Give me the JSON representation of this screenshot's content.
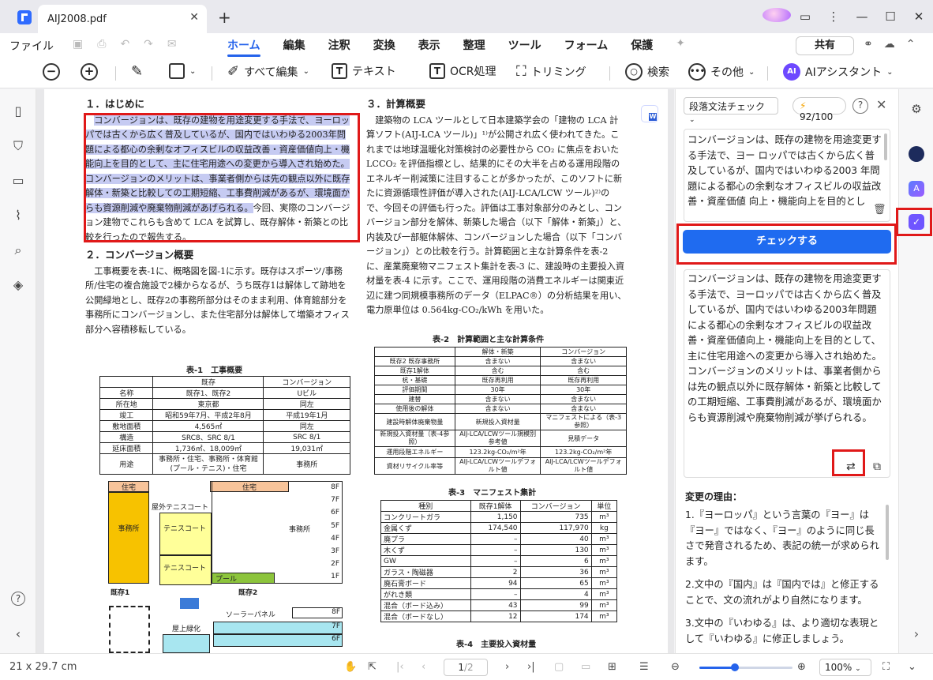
{
  "window": {
    "tab_title": "AIJ2008.pdf",
    "close_glyph": "✕",
    "newtab_glyph": "+",
    "min_glyph": "—",
    "max_glyph": "☐",
    "win_close_glyph": "✕"
  },
  "menu": {
    "file_label": "ファイル",
    "tabs": [
      "ホーム",
      "編集",
      "注釈",
      "変換",
      "表示",
      "整理",
      "ツール",
      "フォーム",
      "保護"
    ],
    "active_tab": "ホーム",
    "share_label": "共有"
  },
  "toolbar": {
    "edit_all": "すべて編集",
    "text": "テキスト",
    "ocr": "OCR処理",
    "trim": "トリミング",
    "search": "検索",
    "more": "その他",
    "ai_assistant": "AIアシスタント",
    "ai_badge": "AI"
  },
  "document": {
    "sec1_title": "１．はじめに",
    "sec1_highlighted": "コンバージョンは、既存の建物を用途変更する手法で、ヨーロッパでは古くから広く普及しているが、国内ではいわゆる2003年問題による都心の余剰なオフィスビルの収益改善・資産価値向上・機能向上を目的として、主に住宅用途への変更から導入され始めた。コンバージョンのメリットは、事業者側からは先の観点以外に既存解体・新築と比較しての工期短縮、工事費削減があるが、環境面からも資源削減や廃棄物削減があげられる。",
    "sec1_rest": "今回、実際のコンバージョン建物でこれらも含めて LCA を試算し、既存解体・新築との比較を行ったので報告する。",
    "sec2_title": "２．コンバージョン概要",
    "sec2_body": "工事概要を表-1に、概略図を図-1に示す。既存はスポーツ/事務所/住宅の複合施設で2棟からなるが、うち既存1は解体して跡地を公開緑地とし、既存2の事務所部分はそのまま利用、体育館部分を事務所にコンバージョンし、また住宅部分は解体して増築オフィス部分へ容積移転している。",
    "sec3_title": "３．計算概要",
    "sec3_body": "建築物の LCA ツールとして日本建築学会の「建物の LCA 計算ソフト(AIJ-LCA ツール)」¹⁾が公開され広く使われてきた。これまでは地球温暖化対策検討の必要性から CO₂ に焦点をおいた LCCO₂ を評価指標とし、結果的にその大半を占める運用段階のエネルギー削減策に注目することが多かったが、このソフトに新たに資源循環性評価が導入された(AIJ-LCA/LCW ツール)²⁾ので、今回その評価も行った。評価は工事対象部分のみとし、コンバージョン部分を解体、新築した場合（以下「解体・新築」）と、内装及び一部躯体解体、コンバージョンした場合（以下「コンバージョン」）との比較を行う。計算範囲と主な計算条件を表-2 に、産業廃棄物マニフェスト集計を表-3 に、建設時の主要投入資材量を表-4 に示す。ここで、運用段階の消費エネルギーは関東近辺に建つ同規模事務所のデータ（ELPAC®）の分析結果を用い、電力原単位は 0.564kg-CO₂/kWh を用いた。",
    "table1": {
      "caption": "表-1　工事概要",
      "header": [
        "",
        "既存",
        "コンバージョン"
      ],
      "rows": [
        [
          "名称",
          "既存1、既存2",
          "Uビル"
        ],
        [
          "所在地",
          "東京都",
          "同左"
        ],
        [
          "竣工",
          "昭和59年7月、平成2年8月",
          "平成19年1月"
        ],
        [
          "敷地面積",
          "4,565㎡",
          "同左"
        ],
        [
          "構造",
          "SRC8、SRC 8/1",
          "SRC 8/1"
        ],
        [
          "延床面積",
          "1,736㎡、18,009㎡",
          "19,031㎡"
        ],
        [
          "用途",
          "事務所・住宅、事務所・体育館(プール・テニス)・住宅",
          "事務所"
        ]
      ]
    },
    "table2": {
      "caption": "表-2　計算範囲と主な計算条件",
      "header": [
        "",
        "解体・新築",
        "コンバージョン"
      ],
      "rows": [
        [
          "既存2 既存事務所",
          "含まない",
          "含まない"
        ],
        [
          "既存1解体",
          "含む",
          "含む"
        ],
        [
          "杭・基礎",
          "既存再利用",
          "既存再利用"
        ],
        [
          "評価期間",
          "30年",
          "30年"
        ],
        [
          "建替",
          "含まない",
          "含まない"
        ],
        [
          "使用後の解体",
          "含まない",
          "含まない"
        ],
        [
          "建設時解体廃棄物量",
          "新規投入資材量",
          "マニフェストによる（表-3参照）"
        ],
        [
          "新規投入資材量（表-4参照）",
          "AIJ-LCA/LCWツール規模別参考値",
          "見積データ"
        ],
        [
          "運用段階エネルギー",
          "123.2kg-CO₂/m²年",
          "123.2kg-CO₂/m²年"
        ],
        [
          "資材リサイクル率等",
          "AIJ-LCA/LCWツールデフォルト値",
          "AIJ-LCA/LCWツールデフォルト値"
        ]
      ]
    },
    "table3": {
      "caption": "表-3　マニフェスト集計",
      "header": [
        "種別",
        "既存1解体",
        "コンバージョン",
        "単位"
      ],
      "rows": [
        [
          "コンクリートガラ",
          "1,150",
          "735",
          "m³"
        ],
        [
          "金属くず",
          "174,540",
          "117,970",
          "kg"
        ],
        [
          "廃プラ",
          "–",
          "40",
          "m³"
        ],
        [
          "木くず",
          "–",
          "130",
          "m³"
        ],
        [
          "GW",
          "–",
          "6",
          "m³"
        ],
        [
          "ガラス・陶磁器",
          "2",
          "36",
          "m³"
        ],
        [
          "廃石膏ボード",
          "94",
          "65",
          "m³"
        ],
        [
          "がれき類",
          "–",
          "4",
          "m³"
        ],
        [
          "混合（ボード込み）",
          "43",
          "99",
          "m³"
        ],
        [
          "混合（ボードなし）",
          "12",
          "174",
          "m³"
        ]
      ]
    },
    "table4_caption": "表-4　主要投入資材量",
    "figure": {
      "house1": "住宅",
      "house2": "住宅",
      "office": "事務所",
      "tennis_outdoor": "屋外テニスコート",
      "tennis1": "テニスコート",
      "tennis2": "テニスコート",
      "office2": "事務所",
      "pool": "プール",
      "floors": [
        "8F",
        "7F",
        "6F",
        "5F",
        "4F",
        "3F",
        "2F",
        "1F"
      ],
      "label1": "既存1",
      "label2": "既存2",
      "solar": "ソーラーパネル",
      "roof": "屋上緑化",
      "f8": "8F",
      "f7": "7F",
      "f6": "6F"
    }
  },
  "panel": {
    "mode": "段落文法チェック",
    "credits": "92/100",
    "input_text": "コンバージョンは、既存の建物を用途変更する手法で、ヨー ロッパでは古くから広く普及しているが、国内ではいわゆる2003 年問題による都心の余剰なオフィスビルの収益改善・資産価値 向上・機能向上を目的とし",
    "check_button": "チェックする",
    "output_text": "コンバージョンは、既存の建物を用途変更する手法で、ヨーロッパでは古くから広く普及しているが、国内ではいわゆる2003年問題による都心の余剰なオフィスビルの収益改善・資産価値向上・機能向上を目的として、主に住宅用途への変更から導入され始めた。コンバージョンのメリットは、事業者側からは先の観点以外に既存解体・新築と比較しての工期短縮、工事費削減があるが、環境面からも資源削減や廃棄物削減が挙げられる。",
    "reasons_title": "変更の理由：",
    "reasons": [
      "1.『ヨーロッパ』という言葉の『ヨー』は『ヨー』ではなく、『ヨー』のように同じ長さで発音されるため、表記の統一が求められます。",
      "2.文中の『国内』は『国内では』と修正することで、文の流れがより自然になります。",
      "3.文中の『いわゆる』は、より適切な表現として『いわゆる』に修正しましょう。"
    ]
  },
  "status": {
    "page_size": "21 x 29.7 cm",
    "page_current": "1",
    "page_total": "/2",
    "zoom": "100%",
    "zoom_level": 0.38
  },
  "icons": {
    "sidebar": [
      "page-icon",
      "bookmark-icon",
      "comment-icon",
      "attachment-icon",
      "search-icon",
      "layers-icon"
    ],
    "rail": [
      "settings-sliders-icon",
      "ai-bot-icon",
      "translate-icon",
      "grammar-check-icon"
    ]
  }
}
